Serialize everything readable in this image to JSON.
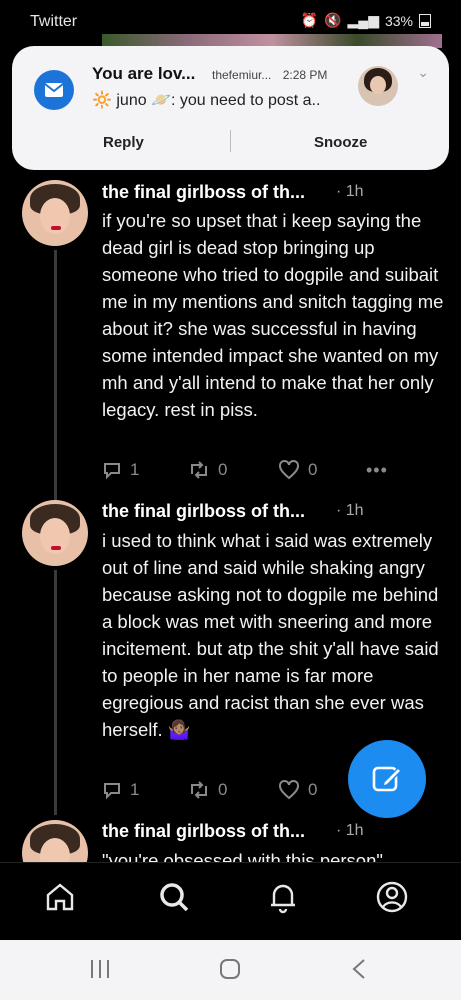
{
  "status_bar": {
    "app_name": "Twitter",
    "battery": "33%"
  },
  "notification": {
    "title": "You are lov...",
    "source": "thefemiur...",
    "time": "2:28 PM",
    "body": "🔆 juno 🪐: you need to post a..",
    "actions": [
      "Reply",
      "Snooze"
    ]
  },
  "feed": {
    "tweets": [
      {
        "name": "the final girlboss of th...",
        "time": "· 1h",
        "text": "if you're so upset that i keep saying the dead girl is dead stop bringing up someone who tried to dogpile and suibait me in my mentions and snitch tagging me about it? she was successful in having some intended impact she wanted on my mh and y'all intend to make that her only legacy. rest in piss.",
        "replies": "1",
        "retweets": "0",
        "likes": "0",
        "more": "•••"
      },
      {
        "name": "the final girlboss of th...",
        "time": "· 1h",
        "text": "i used to think what i said was extremely out of line and said while shaking angry because asking not to dogpile me behind a block was met with sneering and more incitement. but atp the shit y'all have said to people in her name is far more egregious and racist than she ever was herself. 🤷🏽‍♀️",
        "replies": "1",
        "retweets": "0",
        "likes": "0"
      },
      {
        "name": "the final girlboss of th...",
        "time": "· 1h",
        "text": "\"you're obsessed with this person\""
      }
    ]
  },
  "bottom_nav": {
    "items": [
      "home-icon",
      "search-icon",
      "notifications-icon",
      "profile-icon"
    ]
  },
  "system_nav": {
    "items": [
      "recent-apps-icon",
      "home-circle-icon",
      "back-icon"
    ]
  },
  "colors": {
    "accent": "#1d8cf0",
    "notification_app_icon": "#1d74d8",
    "background": "#000000"
  }
}
